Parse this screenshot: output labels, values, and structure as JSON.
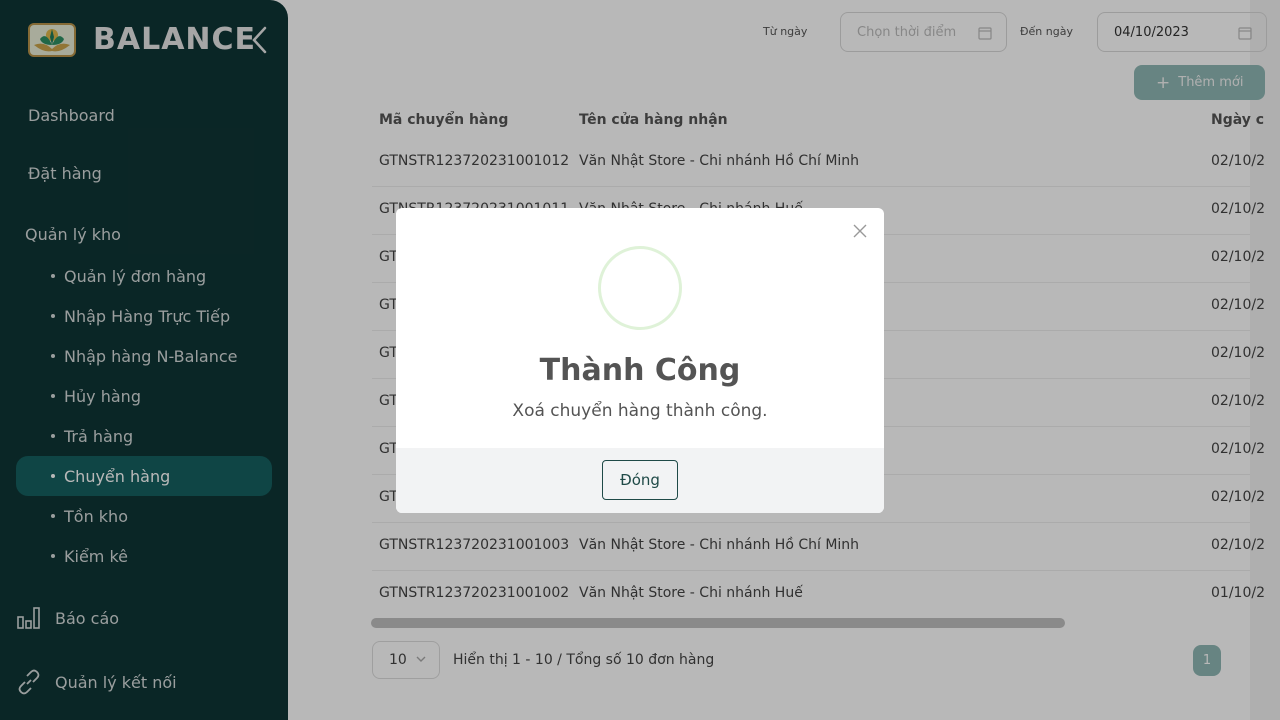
{
  "sidebar": {
    "brand": "BALANCE",
    "items": [
      {
        "label": "Dashboard"
      },
      {
        "label": "Đặt hàng"
      }
    ],
    "section_label": "Quản lý kho",
    "sub_items": [
      {
        "label": "Quản lý đơn hàng"
      },
      {
        "label": "Nhập Hàng Trực Tiếp"
      },
      {
        "label": "Nhập hàng N-Balance"
      },
      {
        "label": "Hủy hàng"
      },
      {
        "label": "Trả hàng"
      },
      {
        "label": "Chuyển hàng",
        "active": true
      },
      {
        "label": "Tồn kho"
      },
      {
        "label": "Kiểm kê"
      }
    ],
    "report_label": "Báo cáo",
    "connect_label": "Quản lý kết nối"
  },
  "filters": {
    "from_label": "Từ ngày",
    "from_placeholder": "Chọn thời điểm",
    "to_label": "Đến ngày",
    "to_value": "04/10/2023"
  },
  "add_button": "Thêm mới",
  "table": {
    "columns": [
      "Mã chuyển hàng",
      "Tên cửa hàng nhận",
      "Ngày c"
    ],
    "rows": [
      {
        "code": "GTNSTR123720231001012",
        "store": "Văn Nhật Store - Chi nhánh Hồ Chí Minh",
        "date": "02/10/2"
      },
      {
        "code": "GTNSTR123720231001011",
        "store": "Văn Nhật Store - Chi nhánh Huế",
        "date": "02/10/2"
      },
      {
        "code": "GT",
        "store": "",
        "date": "02/10/2"
      },
      {
        "code": "GT",
        "store": "",
        "date": "02/10/2"
      },
      {
        "code": "GT",
        "store": "",
        "date": "02/10/2"
      },
      {
        "code": "GT",
        "store": "",
        "date": "02/10/2"
      },
      {
        "code": "GT",
        "store": "",
        "date": "02/10/2"
      },
      {
        "code": "GT",
        "store": "",
        "date": "02/10/2"
      },
      {
        "code": "GTNSTR123720231001003",
        "store": "Văn Nhật Store - Chi nhánh Hồ Chí Minh",
        "date": "02/10/2"
      },
      {
        "code": "GTNSTR123720231001002",
        "store": "Văn Nhật Store - Chi nhánh Huế",
        "date": "01/10/2"
      }
    ]
  },
  "pagination": {
    "page_size": "10",
    "info": "Hiển thị 1 - 10 / Tổng số 10 đơn hàng",
    "current_page": "1"
  },
  "modal": {
    "title": "Thành Công",
    "message": "Xoá chuyển hàng thành công.",
    "close_label": "Đóng"
  }
}
